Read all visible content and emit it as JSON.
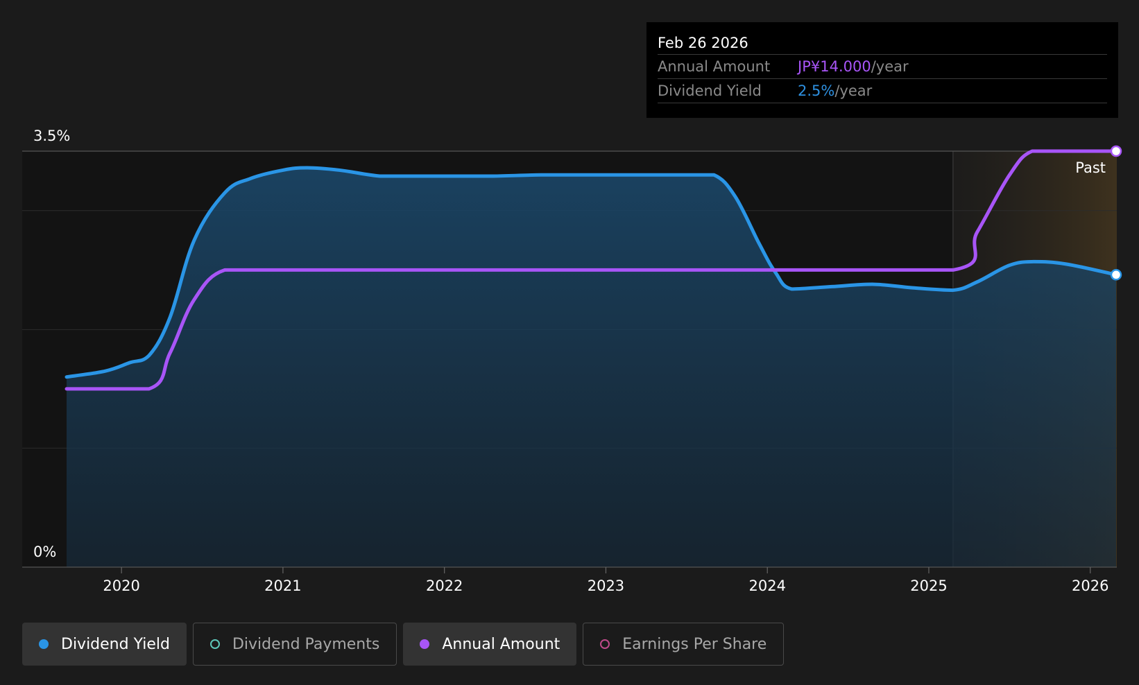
{
  "tooltip": {
    "date": "Feb 26 2026",
    "annual_amount_label": "Annual Amount",
    "annual_amount_value": "JP¥14.000",
    "annual_amount_unit": "/year",
    "dividend_yield_label": "Dividend Yield",
    "dividend_yield_value": "2.5%",
    "dividend_yield_unit": "/year"
  },
  "legend": {
    "items": [
      {
        "label": "Dividend Yield",
        "color": "#2a95e6",
        "active": true
      },
      {
        "label": "Dividend Payments",
        "color": "#5ec8bb",
        "active": false
      },
      {
        "label": "Annual Amount",
        "color": "#a855f7",
        "active": true
      },
      {
        "label": "Earnings Per Share",
        "color": "#c04a8a",
        "active": false
      }
    ]
  },
  "chart_data": {
    "type": "line",
    "y_axis_labels": [
      "3.5%",
      "0%"
    ],
    "ylim": [
      0,
      3.5
    ],
    "x_ticks": [
      "2020",
      "2021",
      "2022",
      "2023",
      "2024",
      "2025",
      "2026"
    ],
    "xlim": [
      2019.66,
      2026.16
    ],
    "past_label": "Past",
    "past_region_start": 2025.15,
    "grid": true,
    "colors": {
      "yield": "#2a95e6",
      "amount": "#a855f7"
    },
    "series": [
      {
        "name": "Dividend Yield",
        "key": "yield",
        "area": true,
        "x": [
          2019.66,
          2019.9,
          2020.05,
          2020.17,
          2020.3,
          2020.45,
          2020.64,
          2020.8,
          2021.0,
          2021.15,
          2021.35,
          2021.6,
          2021.8,
          2022.05,
          2022.3,
          2022.6,
          2022.9,
          2023.2,
          2023.5,
          2023.67,
          2023.8,
          2023.95,
          2024.05,
          2024.15,
          2024.4,
          2024.65,
          2024.9,
          2025.15,
          2025.3,
          2025.5,
          2025.65,
          2025.85,
          2026.16
        ],
        "values": [
          1.6,
          1.65,
          1.72,
          1.78,
          2.1,
          2.75,
          3.15,
          3.27,
          3.34,
          3.36,
          3.34,
          3.29,
          3.29,
          3.29,
          3.29,
          3.3,
          3.3,
          3.3,
          3.3,
          3.3,
          3.12,
          2.72,
          2.48,
          2.34,
          2.36,
          2.38,
          2.35,
          2.33,
          2.4,
          2.54,
          2.57,
          2.55,
          2.46
        ]
      },
      {
        "name": "Annual Amount",
        "key": "amount",
        "area": false,
        "x": [
          2019.66,
          2020.17,
          2020.3,
          2020.45,
          2020.64,
          2021.0,
          2022.0,
          2023.0,
          2024.0,
          2025.15,
          2025.3,
          2025.5,
          2025.64,
          2025.85,
          2026.16
        ],
        "values": [
          1.5,
          1.5,
          1.8,
          2.25,
          2.5,
          2.5,
          2.5,
          2.5,
          2.5,
          2.5,
          2.82,
          3.3,
          3.5,
          3.5,
          3.5
        ]
      }
    ]
  }
}
